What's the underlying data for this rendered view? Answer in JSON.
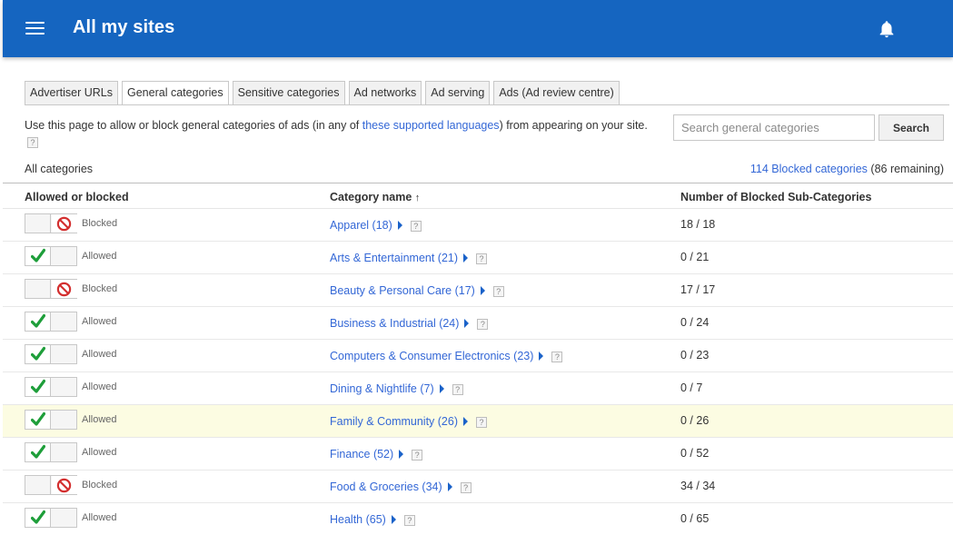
{
  "appbar": {
    "title": "All my sites",
    "menu_icon": "hamburger-menu-icon",
    "notification_icon": "bell-icon",
    "color": "#1565c0"
  },
  "tabs": [
    {
      "label": "Advertiser URLs",
      "active": false
    },
    {
      "label": "General categories",
      "active": true
    },
    {
      "label": "Sensitive categories",
      "active": false
    },
    {
      "label": "Ad networks",
      "active": false
    },
    {
      "label": "Ad serving",
      "active": false
    },
    {
      "label": "Ads (Ad review centre)",
      "active": false
    }
  ],
  "description": {
    "before": "Use this page to allow or block general categories of ads (in any of ",
    "link": "these supported languages",
    "after": ") from appearing on your site.",
    "help": "?"
  },
  "search": {
    "placeholder": "Search general categories",
    "value": "",
    "button_label": "Search"
  },
  "all_categories_label": "All categories",
  "blocked_summary": {
    "link": "114 Blocked categories",
    "remaining": "(86 remaining)"
  },
  "table": {
    "headers": {
      "allowed": "Allowed or blocked",
      "name": "Category name",
      "sort_indicator": "↑",
      "count": "Number of Blocked Sub-Categories"
    },
    "help": "?",
    "rows": [
      {
        "state": "Blocked",
        "name": "Apparel (18)",
        "count": "18 / 18",
        "highlight": false
      },
      {
        "state": "Allowed",
        "name": "Arts & Entertainment (21)",
        "count": "0 / 21",
        "highlight": false
      },
      {
        "state": "Blocked",
        "name": "Beauty & Personal Care (17)",
        "count": "17 / 17",
        "highlight": false
      },
      {
        "state": "Allowed",
        "name": "Business & Industrial (24)",
        "count": "0 / 24",
        "highlight": false
      },
      {
        "state": "Allowed",
        "name": "Computers & Consumer Electronics (23)",
        "count": "0 / 23",
        "highlight": false
      },
      {
        "state": "Allowed",
        "name": "Dining & Nightlife (7)",
        "count": "0 / 7",
        "highlight": false
      },
      {
        "state": "Allowed",
        "name": "Family & Community (26)",
        "count": "0 / 26",
        "highlight": true
      },
      {
        "state": "Allowed",
        "name": "Finance (52)",
        "count": "0 / 52",
        "highlight": false
      },
      {
        "state": "Blocked",
        "name": "Food & Groceries (34)",
        "count": "34 / 34",
        "highlight": false
      },
      {
        "state": "Allowed",
        "name": "Health (65)",
        "count": "0 / 65",
        "highlight": false
      }
    ]
  },
  "colors": {
    "link": "#3367d6",
    "allowed_check": "#1e9e3a",
    "blocked_icon": "#d32f2f",
    "highlight_row": "#fcfce2"
  }
}
